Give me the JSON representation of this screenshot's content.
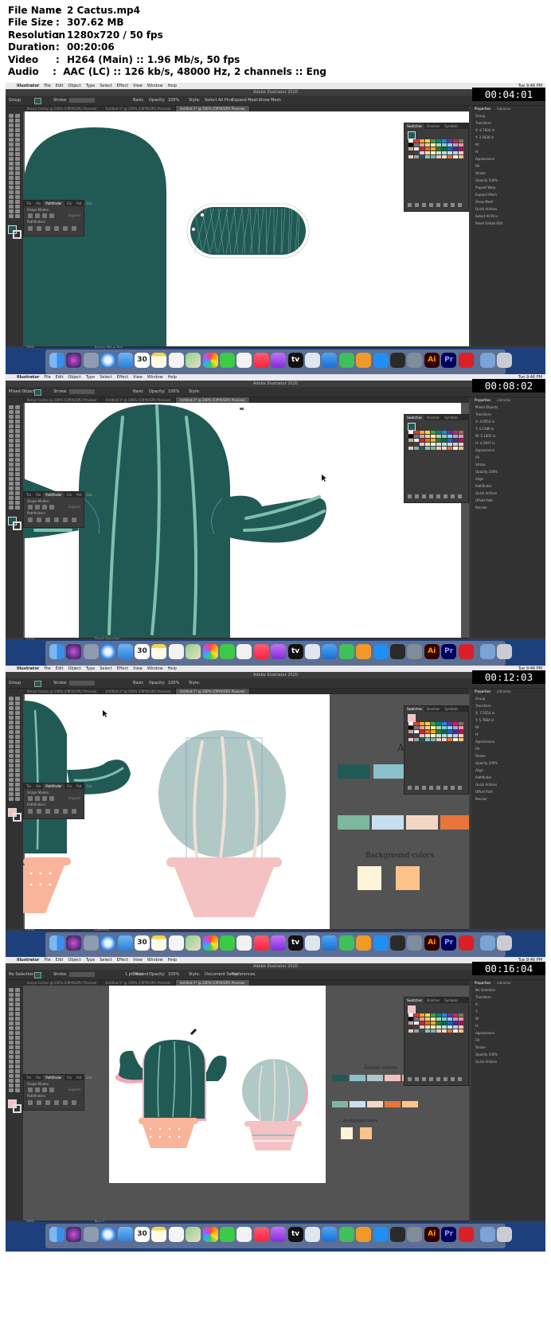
{
  "info": [
    {
      "label": "File Name",
      "value": "2 Cactus.mp4"
    },
    {
      "label": "File Size",
      "value": "307.62 MB"
    },
    {
      "label": "Resolution",
      "value": "1280x720 / 50 fps"
    },
    {
      "label": "Duration",
      "value": "00:20:06"
    },
    {
      "label": "Video",
      "value": "H264 (Main) :: 1.96 Mb/s, 50 fps"
    },
    {
      "label": "Audio",
      "value": "AAC (LC) :: 126 kb/s, 48000 Hz, 2 channels :: Eng"
    }
  ],
  "info_separator": ":",
  "app": {
    "apple_glyph": "",
    "menus": [
      "Illustrator",
      "File",
      "Edit",
      "Object",
      "Type",
      "Select",
      "Effect",
      "View",
      "Window",
      "Help"
    ],
    "clock": "Tue 9:46 PM",
    "title": "Adobe Illustrator 2020",
    "workspace": "Essentials",
    "tabs": [
      "Kenya Cactus @ 100% (CMYK/GPU Preview)",
      "Untitled-1* @ 100% (CMYK/GPU Preview)",
      "Untitled-1* @ 200% (CMYK/GPU Preview)"
    ],
    "panel_tabs": [
      "Properties",
      "Libraries"
    ],
    "swatches_tabs": [
      "Swatches",
      "Brushes",
      "Symbols"
    ],
    "float_tabs": [
      "Tra",
      "Alo",
      "Pathfinder",
      "Clo",
      "Pat",
      "Gra"
    ],
    "shape_modes": "Shape Modes:",
    "pathfinders": "Pathfinders:",
    "expand": "Expand",
    "ctrl": {
      "stroke": "Stroke:",
      "basic": "Basic",
      "opacity": "Opacity:",
      "opacity_val": "100%",
      "style": "Style:"
    },
    "swatch_colors": [
      "#ffffff",
      "#e53935",
      "#f9a825",
      "#fdd835",
      "#43a047",
      "#00897b",
      "#1e88e5",
      "#5e35b1",
      "#d81b60",
      "#8d6e63",
      "#000000",
      "#757575",
      "#ef9a9a",
      "#ffcc80",
      "#fff59d",
      "#a5d6a7",
      "#80cbc4",
      "#90caf9",
      "#b39ddb",
      "#f48fb1",
      "#bcaaa4",
      "#eeeeee",
      "#c62828",
      "#ef6c00",
      "#f9a825",
      "#2e7d32",
      "#00695c",
      "#1565c0",
      "#4527a0",
      "#ad1457",
      "#4e342e",
      "#424242",
      "#f8bbd0",
      "#ffe0b2",
      "#fff9c4",
      "#c8e6c9",
      "#b2dfdb",
      "#bbdefb",
      "#d1c4e9",
      "#ffccbc",
      "#d7ccc8",
      "#9e9e9e",
      "#215a55",
      "#8cc0c8",
      "#7db89e",
      "#f4c2c2",
      "#f2d8c4",
      "#e8753a",
      "#fdf3d8",
      "#fdc38a",
      "#c8dff0",
      "#ffffff",
      "#b0bec5",
      "#607d8b",
      "#e0e0e0",
      "#ffab91",
      "#80deea",
      "#cfd8dc",
      "#263238",
      "#fafafa"
    ],
    "dock_labels": {
      "ai": "Ai",
      "pr": "Pr",
      "calendar": "30",
      "tv": "tv"
    }
  },
  "frames": [
    {
      "timestamp": "00:04:01",
      "selection": "Group",
      "status": "Pointer Move Tool",
      "zoom": "100%",
      "right_panel": [
        "Group",
        "Transform",
        "X: 6.7834 in",
        "Y: 3.5838 in",
        "W:",
        "H:",
        "Appearance",
        "Fill",
        "Stroke",
        "Opacity 100%",
        "Puppet Warp",
        "Expand Mesh",
        "Show Mesh",
        "Quick Actions",
        "Select All Pins",
        "Reset Global Edit"
      ],
      "ctrl_extra": [
        "Select All Pins",
        "Expand Mesh:",
        "Show Mesh"
      ]
    },
    {
      "timestamp": "00:08:02",
      "selection": "Mixed Objects",
      "status": "Direct Selection",
      "zoom": "100%",
      "right_panel": [
        "Mixed Objects",
        "Transform",
        "X: 4.6053 in",
        "Y: 4.1386 in",
        "W: 5.1605 in",
        "H: 4.2947 in",
        "Appearance",
        "Fill",
        "Stroke",
        "Opacity 100%",
        "Align",
        "Pathfinder",
        "Quick Actions",
        "Offset Path",
        "Recolor"
      ],
      "ctrl_extra": []
    },
    {
      "timestamp": "00:12:03",
      "selection": "Group",
      "status": "Selection",
      "zoom": "100%",
      "right_panel": [
        "Group",
        "Transform",
        "X: 7.5554 in",
        "Y: 5.7884 in",
        "W:",
        "H:",
        "Appearance",
        "Fill",
        "Stroke",
        "Opacity 100%",
        "Align",
        "Pathfinder",
        "Quick Actions",
        "Offset Path",
        "Recolor"
      ],
      "ctrl_extra": [],
      "canvas_texts": {
        "accent_letter": "A",
        "background_colors": "Background colors"
      }
    },
    {
      "timestamp": "00:16:04",
      "selection": "No Selection",
      "status": "Pencil",
      "zoom": "100%",
      "right_panel": [
        "No Selection",
        "Transform",
        "X:",
        "Y:",
        "W:",
        "H:",
        "Appearance",
        "Fill",
        "Stroke",
        "Opacity 100%",
        "Quick Actions"
      ],
      "ctrl_extra": [
        "Document Setup",
        "Preferences"
      ],
      "stroke_width": "1 pt. Round",
      "canvas_texts": {
        "accent_colors": "Accent colors",
        "background_colors": "Background colors"
      }
    }
  ],
  "colors": {
    "cactus_green": "#215a55",
    "cactus_spine": "#7fbfae",
    "light_teal": "#8cc0c8",
    "sage": "#b0c8c6",
    "pink_pot": "#f4c2c2",
    "peach_pot": "#f9b49a",
    "cream": "#fdf3d8",
    "peach": "#fdc38a",
    "orange": "#e8753a",
    "light_blue": "#c8dff0",
    "light_peach": "#f2d8c4",
    "mint": "#7db89e",
    "mac_pink": "#f4a7b9"
  },
  "accent_colors": [
    "#215a55",
    "#8cc0c8",
    "#b0c8c6",
    "#f4c2c2",
    "#f9b49a"
  ],
  "secondary_colors": [
    "#7db89e",
    "#c8dff0",
    "#f2d8c4",
    "#e8753a",
    "#fdc38a"
  ],
  "background_colors": [
    "#fdf3d8",
    "#fdc38a"
  ]
}
